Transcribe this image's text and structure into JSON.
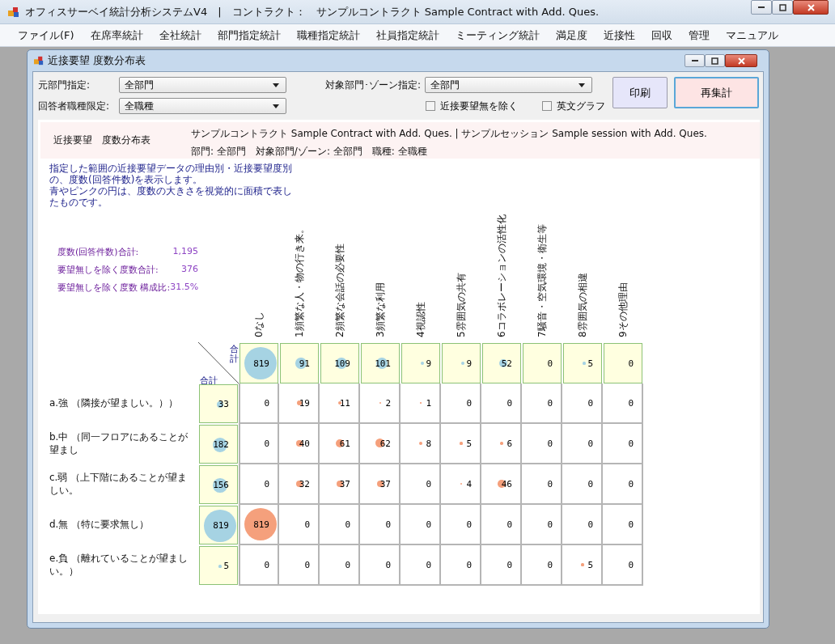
{
  "window": {
    "title": "オフィスサーベイ統計分析システムV4　|　コントラクト：　サンプルコントラクト Sample Contract with Add. Ques."
  },
  "menu": [
    "ファイル(F)",
    "在席率統計",
    "全社統計",
    "部門指定統計",
    "職種指定統計",
    "社員指定統計",
    "ミーティング統計",
    "満足度",
    "近接性",
    "回収",
    "管理",
    "マニュアル"
  ],
  "child_window": {
    "title": "近接要望 度数分布表"
  },
  "filters": [
    {
      "label": "元部門指定:",
      "value": "全部門"
    },
    {
      "label": "回答者職種限定:",
      "value": "全職種"
    },
    {
      "label": "対象部門･ゾーン指定:",
      "value": "全部門"
    }
  ],
  "checkboxes": [
    {
      "label": "近接要望無を除く",
      "checked": false
    },
    {
      "label": "英文グラフ",
      "checked": false
    }
  ],
  "buttons": [
    {
      "label": "印刷",
      "kind": "normal"
    },
    {
      "label": "再集計",
      "kind": "primary"
    }
  ],
  "report": {
    "title": "近接要望　度数分布表",
    "subtitle": "サンプルコントラクト Sample Contract with Add. Ques. | サンプルセッション Sample session with Add. Ques.",
    "conditions": "部門: 全部門　対象部門/ゾーン: 全部門　職種: 全職種",
    "description": [
      "指定した範囲の近接要望データの理由別・近接要望度別の、度数(回答件数)を表示します。",
      "青やピンクの円は、度数の大きさを視覚的に面積で表したものです。"
    ],
    "stats": [
      {
        "label": "度数(回答件数)合計:",
        "value": "1,195"
      },
      {
        "label": "要望無しを除く度数合計:",
        "value": "376"
      },
      {
        "label": "要望無しを除く度数 構成比:",
        "value": "31.5%"
      }
    ],
    "table": {
      "corner_top": "合計",
      "corner_left": "合計",
      "columns": [
        "0なし",
        "1頻繁な人・物の行き来。",
        "2頻繁な会話の必要性",
        "3頻繁な利用",
        "4視認性",
        "5雰囲気の共有",
        "6コラボレーションの活性化",
        "7騒音・空気環境・衛生等",
        "8雰囲気の相違",
        "9その他理由"
      ],
      "totals": [
        "819",
        "91",
        "109",
        "101",
        "9",
        "9",
        "52",
        "0",
        "5",
        "0"
      ],
      "rows": [
        {
          "label": "a.強 （隣接が望ましい。））",
          "total": "33",
          "values": [
            "0",
            "19",
            "11",
            "2",
            "1",
            "0",
            "0",
            "0",
            "0",
            "0"
          ]
        },
        {
          "label": "b.中 （同一フロアにあることが望まし",
          "total": "182",
          "values": [
            "0",
            "40",
            "61",
            "62",
            "8",
            "5",
            "6",
            "0",
            "0",
            "0"
          ]
        },
        {
          "label": "c.弱 （上下階にあることが望ましい。",
          "total": "156",
          "values": [
            "0",
            "32",
            "37",
            "37",
            "0",
            "4",
            "46",
            "0",
            "0",
            "0"
          ]
        },
        {
          "label": "d.無 （特に要求無し）",
          "total": "819",
          "values": [
            "819",
            "0",
            "0",
            "0",
            "0",
            "0",
            "0",
            "0",
            "0",
            "0"
          ]
        },
        {
          "label": "e.負 （離れていることが望ましい。）",
          "total": "5",
          "values": [
            "0",
            "0",
            "0",
            "0",
            "0",
            "0",
            "0",
            "0",
            "5",
            "0"
          ]
        }
      ]
    }
  }
}
